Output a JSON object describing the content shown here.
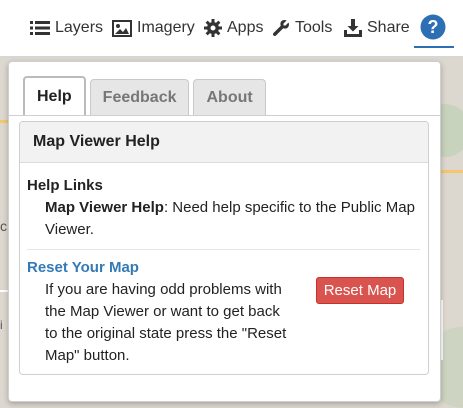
{
  "toolbar": {
    "items": [
      {
        "label": "Layers",
        "icon": "list-icon"
      },
      {
        "label": "Imagery",
        "icon": "image-icon"
      },
      {
        "label": "Apps",
        "icon": "gear-icon"
      },
      {
        "label": "Tools",
        "icon": "wrench-icon"
      },
      {
        "label": "Share",
        "icon": "download-icon"
      }
    ],
    "help_icon": "question-circle-icon",
    "accent": "#2d6fb5"
  },
  "map": {
    "left_label_fragment": "c",
    "bottom_label_fragment": "i"
  },
  "panel": {
    "tabs": [
      {
        "label": "Help",
        "active": true
      },
      {
        "label": "Feedback",
        "active": false
      },
      {
        "label": "About",
        "active": false
      }
    ],
    "header": "Map Viewer Help",
    "help_links": {
      "title": "Help Links",
      "item_bold": "Map Viewer Help",
      "item_text": ": Need help specific to the Public Map Viewer."
    },
    "reset": {
      "title": "Reset Your Map",
      "description": "If you are having odd problems with the Map Viewer or want to get back to the original state press the \"Reset Map\" button.",
      "button_label": "Reset Map",
      "button_color": "#d9534f",
      "link_color": "#337ab7"
    }
  }
}
